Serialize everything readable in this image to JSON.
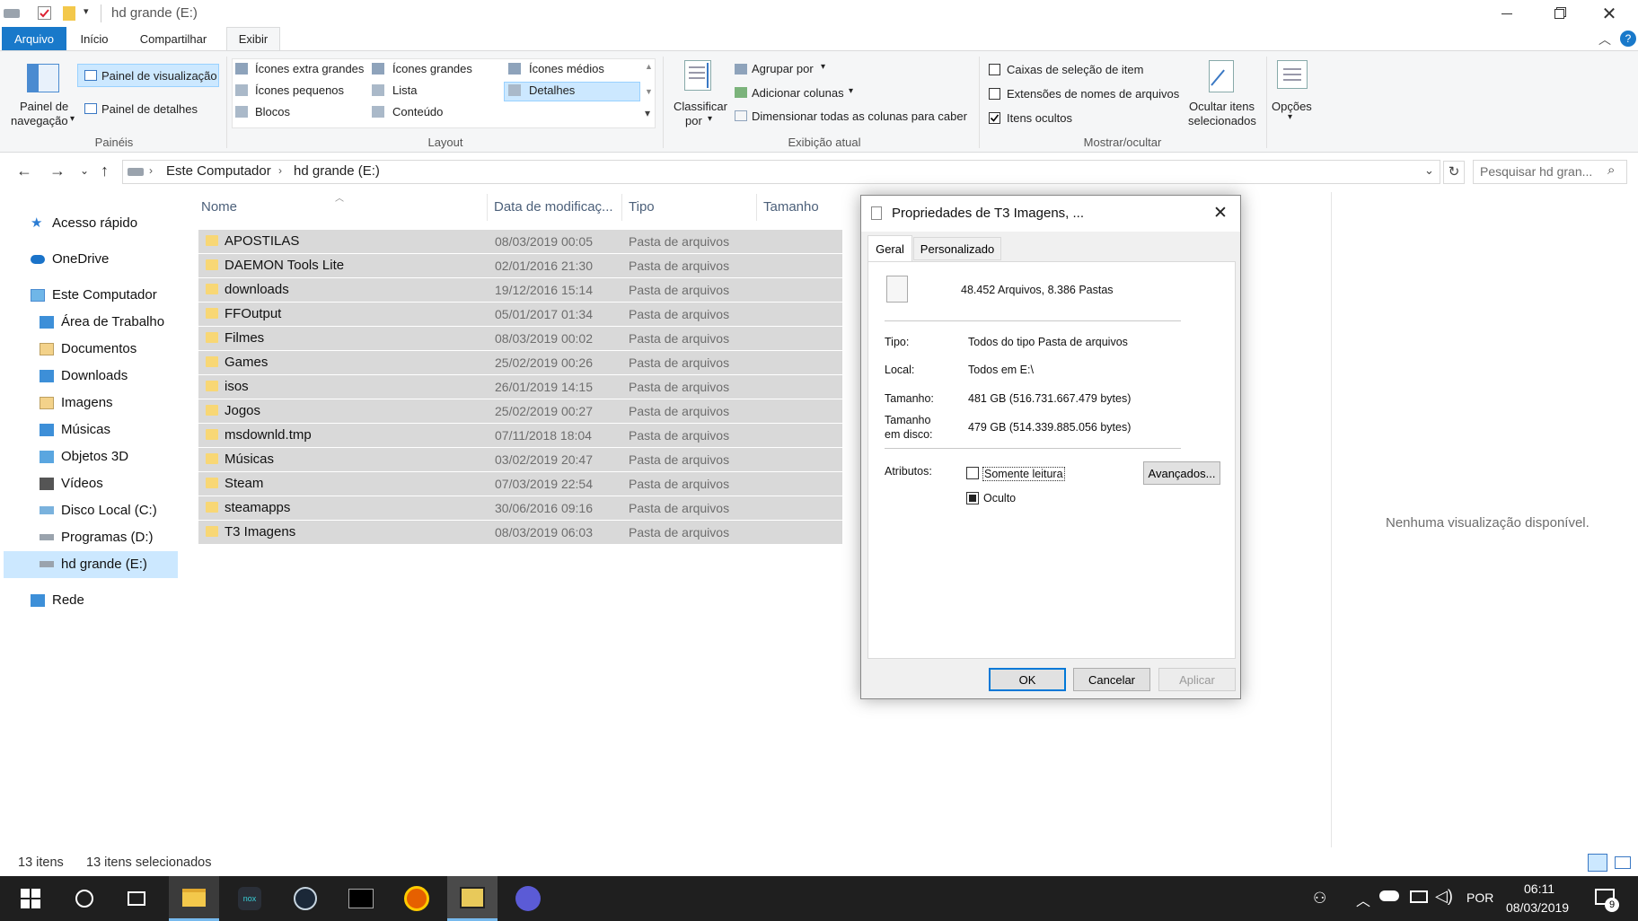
{
  "window": {
    "title": "hd grande (E:)"
  },
  "ribbon": {
    "tabs": [
      "Arquivo",
      "Início",
      "Compartilhar",
      "Exibir"
    ],
    "paineis": {
      "nav_pane_label_1": "Painel de",
      "nav_pane_label_2": "navegação",
      "preview_pane": "Painel de visualização",
      "details_pane": "Painel de detalhes",
      "group": "Painéis"
    },
    "layout": {
      "options": [
        "Ícones extra grandes",
        "Ícones grandes",
        "Ícones médios",
        "Ícones pequenos",
        "Lista",
        "Detalhes",
        "Blocos",
        "Conteúdo"
      ],
      "group": "Layout"
    },
    "current_view": {
      "sort_by_1": "Classificar",
      "sort_by_2": "por",
      "group_by": "Agrupar por",
      "add_columns": "Adicionar colunas",
      "fit_columns": "Dimensionar todas as colunas para caber",
      "group": "Exibição atual"
    },
    "show_hide": {
      "item_checkboxes": "Caixas de seleção de item",
      "extensions": "Extensões de nomes de arquivos",
      "hidden_items": "Itens ocultos",
      "hidden_items_checked": true,
      "hide_selected_1": "Ocultar itens",
      "hide_selected_2": "selecionados",
      "group": "Mostrar/ocultar"
    },
    "options": "Opções"
  },
  "address": {
    "crumbs": [
      "Este Computador",
      "hd grande (E:)"
    ],
    "search_placeholder": "Pesquisar hd gran..."
  },
  "nav": {
    "items": [
      "Acesso rápido",
      "OneDrive",
      "Este Computador",
      "Área de Trabalho",
      "Documentos",
      "Downloads",
      "Imagens",
      "Músicas",
      "Objetos 3D",
      "Vídeos",
      "Disco Local (C:)",
      "Programas (D:)",
      "hd grande (E:)",
      "Rede"
    ]
  },
  "filelist": {
    "columns": [
      "Nome",
      "Data de modificaç...",
      "Tipo",
      "Tamanho"
    ],
    "rows": [
      {
        "name": "APOSTILAS",
        "date": "08/03/2019 00:05",
        "type": "Pasta de arquivos"
      },
      {
        "name": "DAEMON Tools Lite",
        "date": "02/01/2016 21:30",
        "type": "Pasta de arquivos"
      },
      {
        "name": "downloads",
        "date": "19/12/2016 15:14",
        "type": "Pasta de arquivos"
      },
      {
        "name": "FFOutput",
        "date": "05/01/2017 01:34",
        "type": "Pasta de arquivos"
      },
      {
        "name": "Filmes",
        "date": "08/03/2019 00:02",
        "type": "Pasta de arquivos"
      },
      {
        "name": "Games",
        "date": "25/02/2019 00:26",
        "type": "Pasta de arquivos"
      },
      {
        "name": "isos",
        "date": "26/01/2019 14:15",
        "type": "Pasta de arquivos"
      },
      {
        "name": "Jogos",
        "date": "25/02/2019 00:27",
        "type": "Pasta de arquivos"
      },
      {
        "name": "msdownld.tmp",
        "date": "07/11/2018 18:04",
        "type": "Pasta de arquivos"
      },
      {
        "name": "Músicas",
        "date": "03/02/2019 20:47",
        "type": "Pasta de arquivos"
      },
      {
        "name": "Steam",
        "date": "07/03/2019 22:54",
        "type": "Pasta de arquivos"
      },
      {
        "name": "steamapps",
        "date": "30/06/2016 09:16",
        "type": "Pasta de arquivos"
      },
      {
        "name": "T3 Imagens",
        "date": "08/03/2019 06:03",
        "type": "Pasta de arquivos"
      }
    ]
  },
  "preview": {
    "empty": "Nenhuma visualização disponível."
  },
  "dialog": {
    "title": "Propriedades de T3 Imagens, ...",
    "tabs": [
      "Geral",
      "Personalizado"
    ],
    "summary": "48.452 Arquivos, 8.386 Pastas",
    "tipo_label": "Tipo:",
    "tipo_value": "Todos do tipo Pasta de arquivos",
    "local_label": "Local:",
    "local_value": "Todos em E:\\",
    "tamanho_label": "Tamanho:",
    "tamanho_value": "481 GB (516.731.667.479 bytes)",
    "disco_label_1": "Tamanho",
    "disco_label_2": "em disco:",
    "disco_value": "479 GB (514.339.885.056 bytes)",
    "atributos_label": "Atributos:",
    "readonly": "Somente leitura",
    "hidden": "Oculto",
    "advanced": "Avançados...",
    "ok": "OK",
    "cancel": "Cancelar",
    "apply": "Aplicar"
  },
  "status": {
    "count": "13 itens",
    "selected": "13 itens selecionados"
  },
  "taskbar": {
    "lang": "POR",
    "time": "06:11",
    "date": "08/03/2019",
    "notif_count": "9"
  }
}
